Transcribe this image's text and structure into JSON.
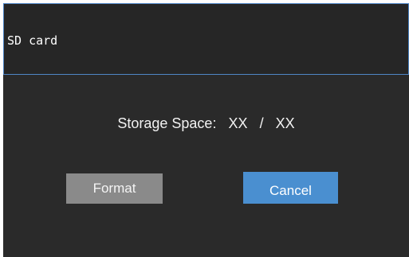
{
  "dialog": {
    "title": "SD card",
    "storage_label": "Storage Space:",
    "storage_used": "XX",
    "storage_separator": "/",
    "storage_total": "XX",
    "format_button": "Format",
    "cancel_button": "Cancel"
  },
  "colors": {
    "background": "#2a2a2a",
    "title_border": "#4f86c6",
    "format_button": "#8a8a8a",
    "cancel_button": "#4a8fd0",
    "text": "#ffffff"
  }
}
